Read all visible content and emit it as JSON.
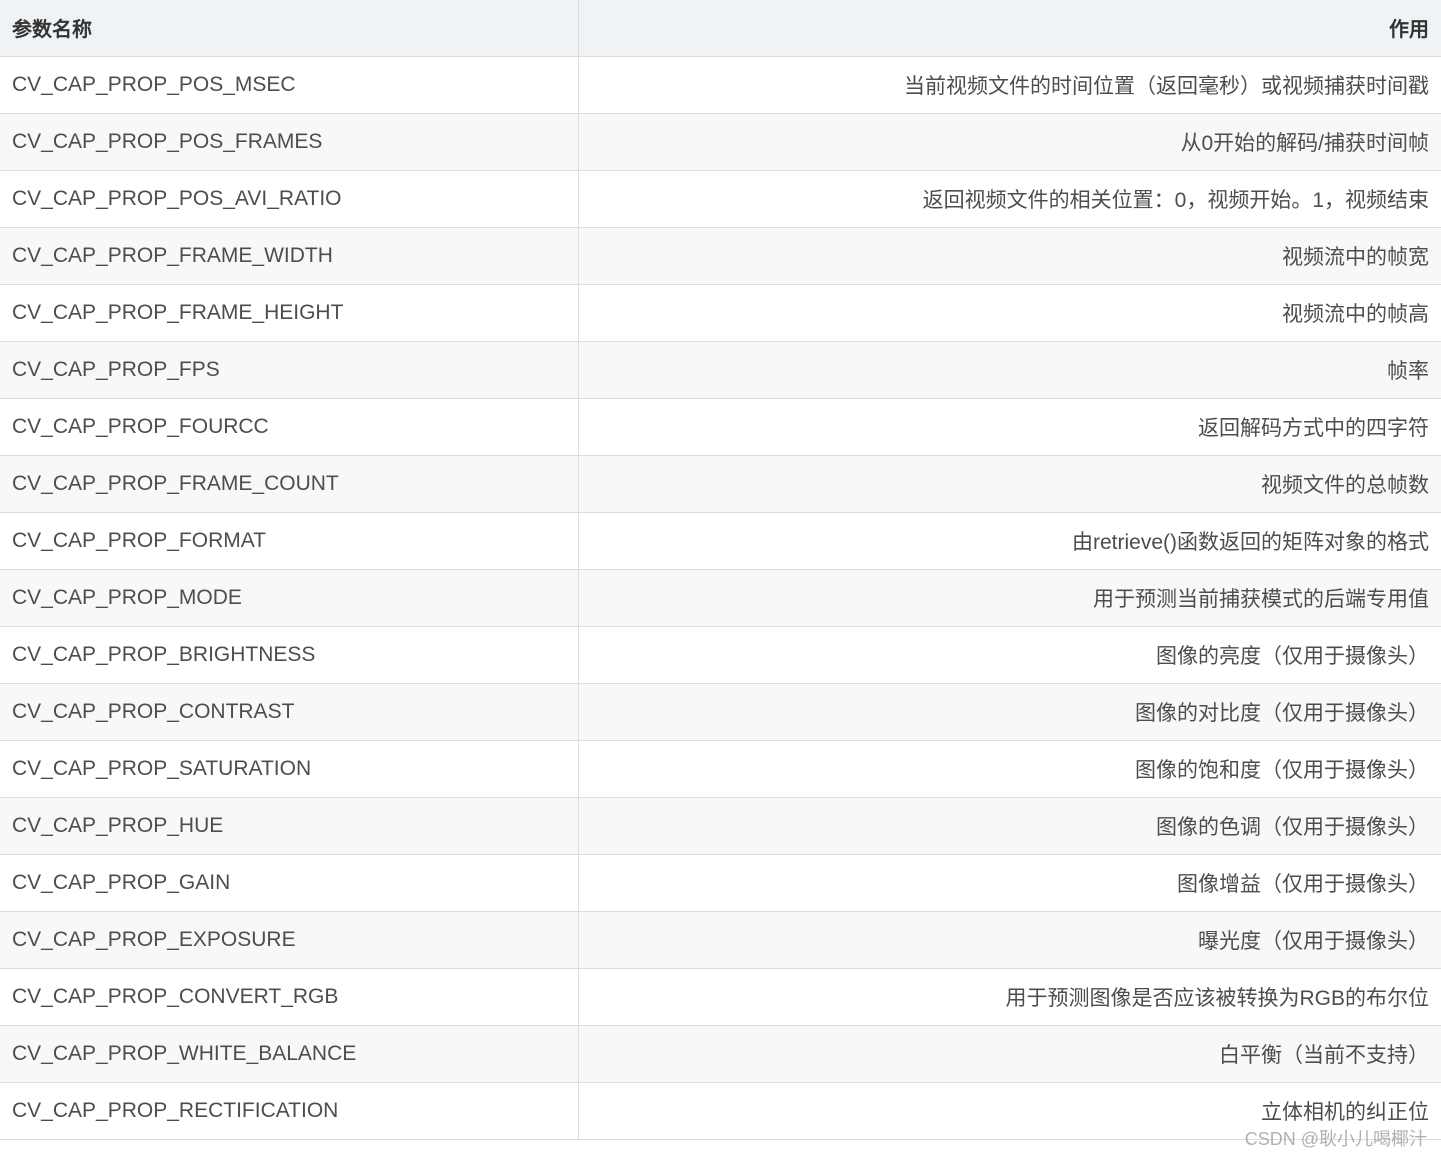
{
  "table": {
    "headers": {
      "name": "参数名称",
      "description": "作用"
    },
    "rows": [
      {
        "name": "CV_CAP_PROP_POS_MSEC",
        "description": "当前视频文件的时间位置（返回毫秒）或视频捕获时间戳"
      },
      {
        "name": "CV_CAP_PROP_POS_FRAMES",
        "description": "从0开始的解码/捕获时间帧"
      },
      {
        "name": "CV_CAP_PROP_POS_AVI_RATIO",
        "description": "返回视频文件的相关位置：0，视频开始。1，视频结束"
      },
      {
        "name": "CV_CAP_PROP_FRAME_WIDTH",
        "description": "视频流中的帧宽"
      },
      {
        "name": "CV_CAP_PROP_FRAME_HEIGHT",
        "description": "视频流中的帧高"
      },
      {
        "name": "CV_CAP_PROP_FPS",
        "description": "帧率"
      },
      {
        "name": "CV_CAP_PROP_FOURCC",
        "description": "返回解码方式中的四字符"
      },
      {
        "name": "CV_CAP_PROP_FRAME_COUNT",
        "description": "视频文件的总帧数"
      },
      {
        "name": "CV_CAP_PROP_FORMAT",
        "description": "由retrieve()函数返回的矩阵对象的格式"
      },
      {
        "name": "CV_CAP_PROP_MODE",
        "description": "用于预测当前捕获模式的后端专用值"
      },
      {
        "name": "CV_CAP_PROP_BRIGHTNESS",
        "description": "图像的亮度（仅用于摄像头）"
      },
      {
        "name": "CV_CAP_PROP_CONTRAST",
        "description": "图像的对比度（仅用于摄像头）"
      },
      {
        "name": "CV_CAP_PROP_SATURATION",
        "description": "图像的饱和度（仅用于摄像头）"
      },
      {
        "name": "CV_CAP_PROP_HUE",
        "description": "图像的色调（仅用于摄像头）"
      },
      {
        "name": "CV_CAP_PROP_GAIN",
        "description": "图像增益（仅用于摄像头）"
      },
      {
        "name": "CV_CAP_PROP_EXPOSURE",
        "description": "曝光度（仅用于摄像头）"
      },
      {
        "name": "CV_CAP_PROP_CONVERT_RGB",
        "description": "用于预测图像是否应该被转换为RGB的布尔位"
      },
      {
        "name": "CV_CAP_PROP_WHITE_BALANCE",
        "description": "白平衡（当前不支持）"
      },
      {
        "name": "CV_CAP_PROP_RECTIFICATION",
        "description": "立体相机的纠正位"
      }
    ]
  },
  "watermark": "CSDN @耿小儿喝椰汁"
}
